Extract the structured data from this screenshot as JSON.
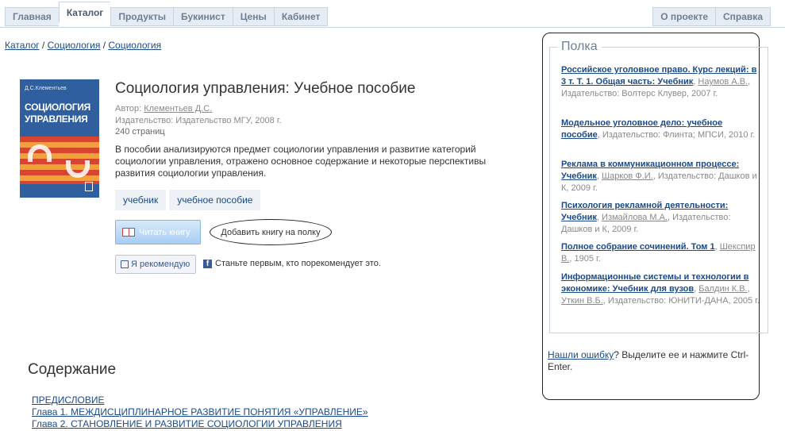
{
  "nav": {
    "left": [
      "Главная",
      "Каталог",
      "Продукты",
      "Букинист",
      "Цены",
      "Кабинет"
    ],
    "right": [
      "О проекте",
      "Справка"
    ]
  },
  "breadcrumb": [
    "Каталог",
    "Социология",
    "Социология"
  ],
  "book": {
    "cover_author": "Д.С.Клементьев",
    "cover_title_1": "СОЦИОЛОГИЯ",
    "cover_title_2": "УПРАВЛЕНИЯ",
    "title": "Социология управления: Учебное пособие",
    "author_label": "Автор:",
    "author": "Клементьев Д.С.",
    "publisher": "Издательство: Издательство МГУ, 2008 г.",
    "pages": "240 страниц",
    "description": "В пособии анализируются предмет социологии управления и развитие категорий социологии управления, отражено основное содержание и некоторые перспективы развития социологии управления.",
    "tags": [
      "учебник",
      "учебное пособие"
    ],
    "read_button": "Читать книгу",
    "add_button": "Добавить книгу на полку",
    "recommend_button": "Я рекомендую",
    "fb_text": "Станьте первым, кто порекомендует это."
  },
  "contents": {
    "heading": "Содержание",
    "items": [
      "ПРЕДИСЛОВИЕ",
      "Глава 1. МЕЖДИСЦИПЛИНАРНОЕ РАЗВИТИЕ ПОНЯТИЯ «УПРАВЛЕНИЕ»",
      "Глава 2. СТАНОВЛЕНИЕ И РАЗВИТИЕ СОЦИОЛОГИИ УПРАВЛЕНИЯ"
    ]
  },
  "shelf": {
    "title": "Полка",
    "entries": [
      {
        "title": "Российское уголовное право. Курс лекций: в 3 т. Т. 1. Общая часть: Учебник",
        "authors": "Наумов А.В.",
        "pub": "Издательство: Волтерс Клувер, 2007 г."
      },
      {
        "title": "Модельное уголовное дело: учебное пособие",
        "authors": "",
        "pub": "Издательство: Флинта; МПСИ, 2010 г."
      },
      {
        "title": "Реклама в коммуникационном процессе: Учебник",
        "authors": "Шарков Ф.И.",
        "pub": "Издательство: Дашков и К, 2009 г."
      },
      {
        "title": "Психология рекламной деятельности: Учебник",
        "authors": "Измайлова М.А.",
        "pub": "Издательство: Дашков и К, 2009 г."
      },
      {
        "title": "Полное собрание сочинений. Том 1",
        "authors": "Шекспир В.",
        "pub": "1905 г."
      },
      {
        "title": "Информационные системы и технологии в экономике: Учебник для вузов",
        "authors_1": "Балдин К.В.",
        "authors_2": "Уткин В.Б.",
        "pub": "Издательство: ЮНИТИ-ДАНА, 2005 г."
      }
    ]
  },
  "error_note": {
    "link": "Нашли ошибку",
    "text": "? Выделите ее и нажмите Ctrl-Enter."
  }
}
